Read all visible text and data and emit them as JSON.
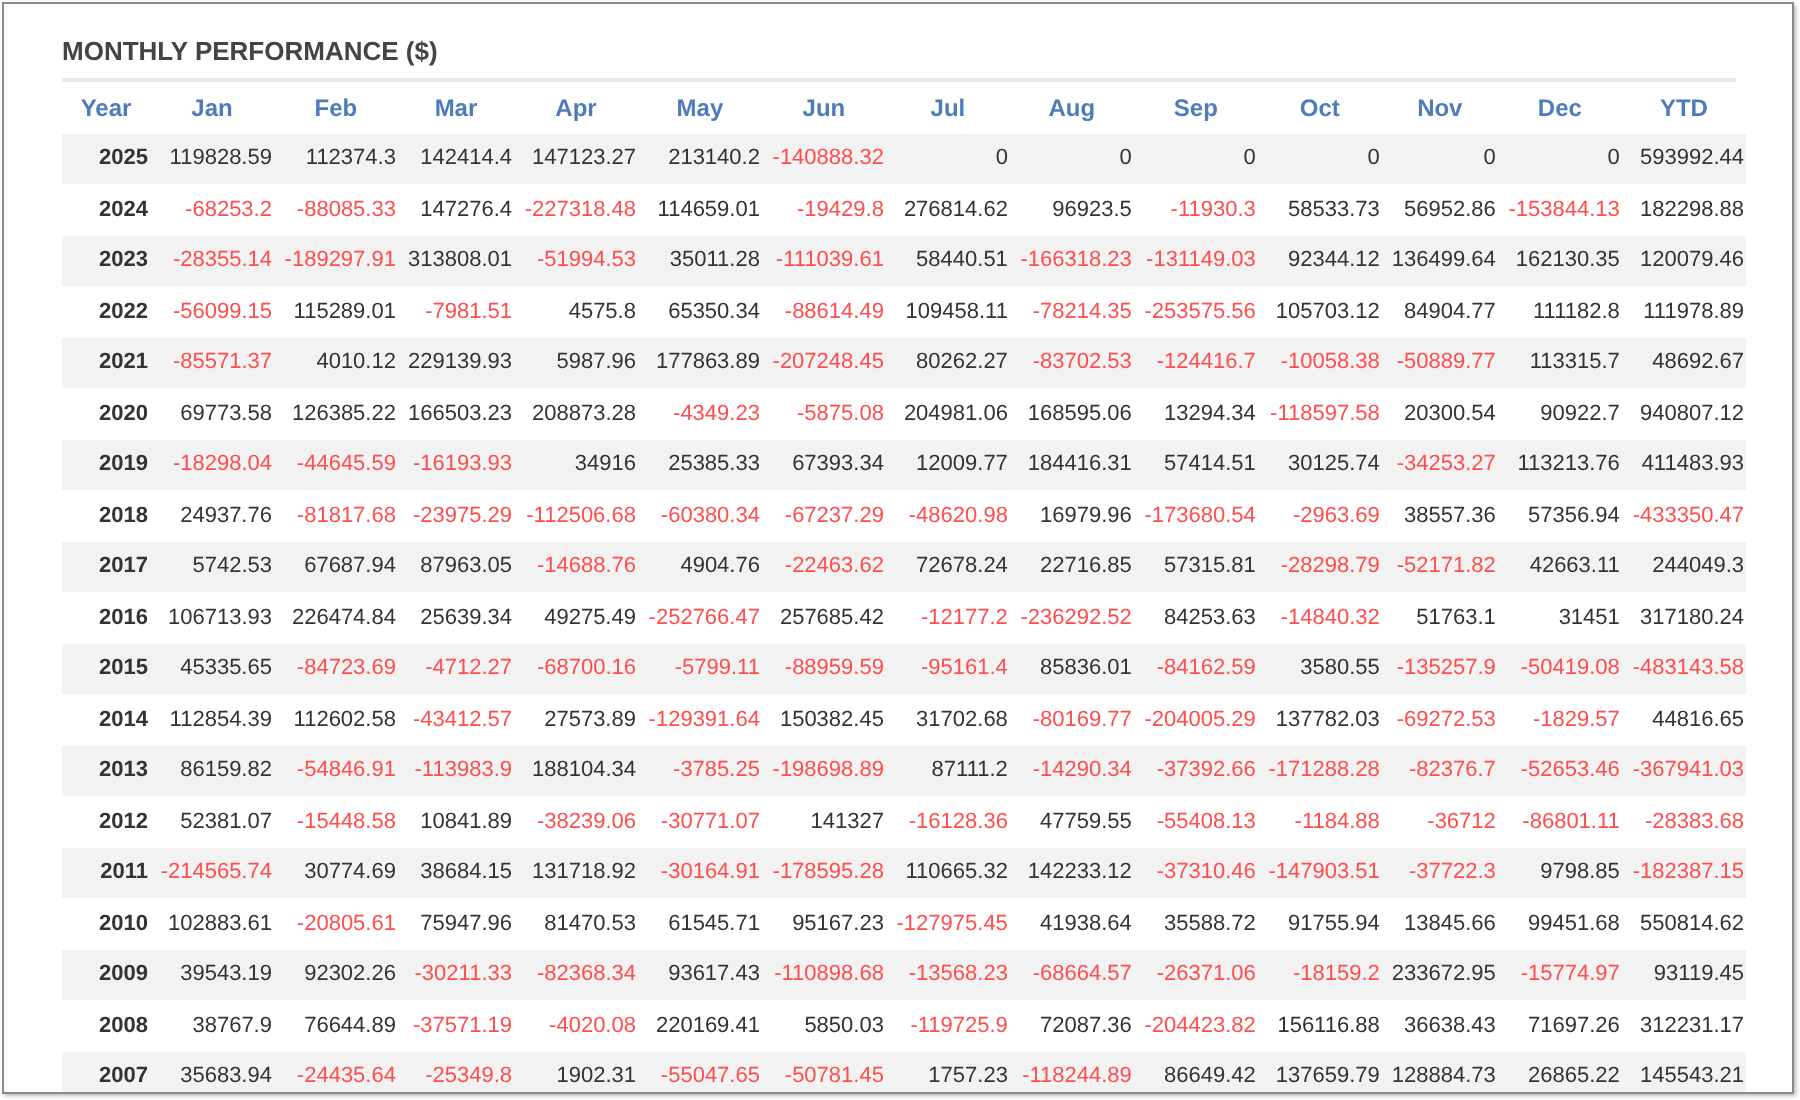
{
  "title": "MONTHLY PERFORMANCE ($)",
  "columns": [
    "Year",
    "Jan",
    "Feb",
    "Mar",
    "Apr",
    "May",
    "Jun",
    "Jul",
    "Aug",
    "Sep",
    "Oct",
    "Nov",
    "Dec",
    "YTD"
  ],
  "rows": [
    {
      "year": "2025",
      "values": [
        "119828.59",
        "112374.3",
        "142414.4",
        "147123.27",
        "213140.2",
        "-140888.32",
        "0",
        "0",
        "0",
        "0",
        "0",
        "0",
        "593992.44"
      ],
      "loss": [
        false,
        false,
        false,
        false,
        false,
        true,
        false,
        false,
        false,
        false,
        false,
        false,
        false
      ]
    },
    {
      "year": "2024",
      "values": [
        "-68253.2",
        "-88085.33",
        "147276.4",
        "-227318.48",
        "114659.01",
        "-19429.8",
        "276814.62",
        "96923.5",
        "-11930.3",
        "58533.73",
        "56952.86",
        "-153844.13",
        "182298.88"
      ],
      "loss": [
        true,
        true,
        false,
        true,
        false,
        true,
        false,
        false,
        true,
        false,
        false,
        true,
        false
      ]
    },
    {
      "year": "2023",
      "values": [
        "-28355.14",
        "-189297.91",
        "313808.01",
        "-51994.53",
        "35011.28",
        "-111039.61",
        "58440.51",
        "-166318.23",
        "-131149.03",
        "92344.12",
        "136499.64",
        "162130.35",
        "120079.46"
      ],
      "loss": [
        true,
        true,
        false,
        true,
        false,
        true,
        false,
        true,
        true,
        false,
        false,
        false,
        false
      ]
    },
    {
      "year": "2022",
      "values": [
        "-56099.15",
        "115289.01",
        "-7981.51",
        "4575.8",
        "65350.34",
        "-88614.49",
        "109458.11",
        "-78214.35",
        "-253575.56",
        "105703.12",
        "84904.77",
        "111182.8",
        "111978.89"
      ],
      "loss": [
        true,
        false,
        true,
        false,
        false,
        true,
        false,
        true,
        true,
        false,
        false,
        false,
        false
      ]
    },
    {
      "year": "2021",
      "values": [
        "-85571.37",
        "4010.12",
        "229139.93",
        "5987.96",
        "177863.89",
        "-207248.45",
        "80262.27",
        "-83702.53",
        "-124416.7",
        "-10058.38",
        "-50889.77",
        "113315.7",
        "48692.67"
      ],
      "loss": [
        true,
        false,
        false,
        false,
        false,
        true,
        false,
        true,
        true,
        true,
        true,
        false,
        false
      ]
    },
    {
      "year": "2020",
      "values": [
        "69773.58",
        "126385.22",
        "166503.23",
        "208873.28",
        "-4349.23",
        "-5875.08",
        "204981.06",
        "168595.06",
        "13294.34",
        "-118597.58",
        "20300.54",
        "90922.7",
        "940807.12"
      ],
      "loss": [
        false,
        false,
        false,
        false,
        true,
        true,
        false,
        false,
        false,
        true,
        false,
        false,
        false
      ]
    },
    {
      "year": "2019",
      "values": [
        "-18298.04",
        "-44645.59",
        "-16193.93",
        "34916",
        "25385.33",
        "67393.34",
        "12009.77",
        "184416.31",
        "57414.51",
        "30125.74",
        "-34253.27",
        "113213.76",
        "411483.93"
      ],
      "loss": [
        true,
        true,
        true,
        false,
        false,
        false,
        false,
        false,
        false,
        false,
        true,
        false,
        false
      ]
    },
    {
      "year": "2018",
      "values": [
        "24937.76",
        "-81817.68",
        "-23975.29",
        "-112506.68",
        "-60380.34",
        "-67237.29",
        "-48620.98",
        "16979.96",
        "-173680.54",
        "-2963.69",
        "38557.36",
        "57356.94",
        "-433350.47"
      ],
      "loss": [
        false,
        true,
        true,
        true,
        true,
        true,
        true,
        false,
        true,
        true,
        false,
        false,
        true
      ]
    },
    {
      "year": "2017",
      "values": [
        "5742.53",
        "67687.94",
        "87963.05",
        "-14688.76",
        "4904.76",
        "-22463.62",
        "72678.24",
        "22716.85",
        "57315.81",
        "-28298.79",
        "-52171.82",
        "42663.11",
        "244049.3"
      ],
      "loss": [
        false,
        false,
        false,
        true,
        false,
        true,
        false,
        false,
        false,
        true,
        true,
        false,
        false
      ]
    },
    {
      "year": "2016",
      "values": [
        "106713.93",
        "226474.84",
        "25639.34",
        "49275.49",
        "-252766.47",
        "257685.42",
        "-12177.2",
        "-236292.52",
        "84253.63",
        "-14840.32",
        "51763.1",
        "31451",
        "317180.24"
      ],
      "loss": [
        false,
        false,
        false,
        false,
        true,
        false,
        true,
        true,
        false,
        true,
        false,
        false,
        false
      ]
    },
    {
      "year": "2015",
      "values": [
        "45335.65",
        "-84723.69",
        "-4712.27",
        "-68700.16",
        "-5799.11",
        "-88959.59",
        "-95161.4",
        "85836.01",
        "-84162.59",
        "3580.55",
        "-135257.9",
        "-50419.08",
        "-483143.58"
      ],
      "loss": [
        false,
        true,
        true,
        true,
        true,
        true,
        true,
        false,
        true,
        false,
        true,
        true,
        true
      ]
    },
    {
      "year": "2014",
      "values": [
        "112854.39",
        "112602.58",
        "-43412.57",
        "27573.89",
        "-129391.64",
        "150382.45",
        "31702.68",
        "-80169.77",
        "-204005.29",
        "137782.03",
        "-69272.53",
        "-1829.57",
        "44816.65"
      ],
      "loss": [
        false,
        false,
        true,
        false,
        true,
        false,
        false,
        true,
        true,
        false,
        true,
        true,
        false
      ]
    },
    {
      "year": "2013",
      "values": [
        "86159.82",
        "-54846.91",
        "-113983.9",
        "188104.34",
        "-3785.25",
        "-198698.89",
        "87111.2",
        "-14290.34",
        "-37392.66",
        "-171288.28",
        "-82376.7",
        "-52653.46",
        "-367941.03"
      ],
      "loss": [
        false,
        true,
        true,
        false,
        true,
        true,
        false,
        true,
        true,
        true,
        true,
        true,
        true
      ]
    },
    {
      "year": "2012",
      "values": [
        "52381.07",
        "-15448.58",
        "10841.89",
        "-38239.06",
        "-30771.07",
        "141327",
        "-16128.36",
        "47759.55",
        "-55408.13",
        "-1184.88",
        "-36712",
        "-86801.11",
        "-28383.68"
      ],
      "loss": [
        false,
        true,
        false,
        true,
        true,
        false,
        true,
        false,
        true,
        true,
        true,
        true,
        true
      ]
    },
    {
      "year": "2011",
      "values": [
        "-214565.74",
        "30774.69",
        "38684.15",
        "131718.92",
        "-30164.91",
        "-178595.28",
        "110665.32",
        "142233.12",
        "-37310.46",
        "-147903.51",
        "-37722.3",
        "9798.85",
        "-182387.15"
      ],
      "loss": [
        true,
        false,
        false,
        false,
        true,
        true,
        false,
        false,
        true,
        true,
        true,
        false,
        true
      ]
    },
    {
      "year": "2010",
      "values": [
        "102883.61",
        "-20805.61",
        "75947.96",
        "81470.53",
        "61545.71",
        "95167.23",
        "-127975.45",
        "41938.64",
        "35588.72",
        "91755.94",
        "13845.66",
        "99451.68",
        "550814.62"
      ],
      "loss": [
        false,
        true,
        false,
        false,
        false,
        false,
        true,
        false,
        false,
        false,
        false,
        false,
        false
      ]
    },
    {
      "year": "2009",
      "values": [
        "39543.19",
        "92302.26",
        "-30211.33",
        "-82368.34",
        "93617.43",
        "-110898.68",
        "-13568.23",
        "-68664.57",
        "-26371.06",
        "-18159.2",
        "233672.95",
        "-15774.97",
        "93119.45"
      ],
      "loss": [
        false,
        false,
        true,
        true,
        false,
        true,
        true,
        true,
        true,
        true,
        false,
        true,
        false
      ]
    },
    {
      "year": "2008",
      "values": [
        "38767.9",
        "76644.89",
        "-37571.19",
        "-4020.08",
        "220169.41",
        "5850.03",
        "-119725.9",
        "72087.36",
        "-204423.82",
        "156116.88",
        "36638.43",
        "71697.26",
        "312231.17"
      ],
      "loss": [
        false,
        false,
        true,
        true,
        false,
        false,
        true,
        false,
        true,
        false,
        false,
        false,
        false
      ]
    },
    {
      "year": "2007",
      "values": [
        "35683.94",
        "-24435.64",
        "-25349.8",
        "1902.31",
        "-55047.65",
        "-50781.45",
        "1757.23",
        "-118244.89",
        "86649.42",
        "137659.79",
        "128884.73",
        "26865.22",
        "145543.21"
      ],
      "loss": [
        false,
        true,
        true,
        false,
        true,
        true,
        false,
        true,
        false,
        false,
        false,
        false,
        false
      ]
    }
  ]
}
